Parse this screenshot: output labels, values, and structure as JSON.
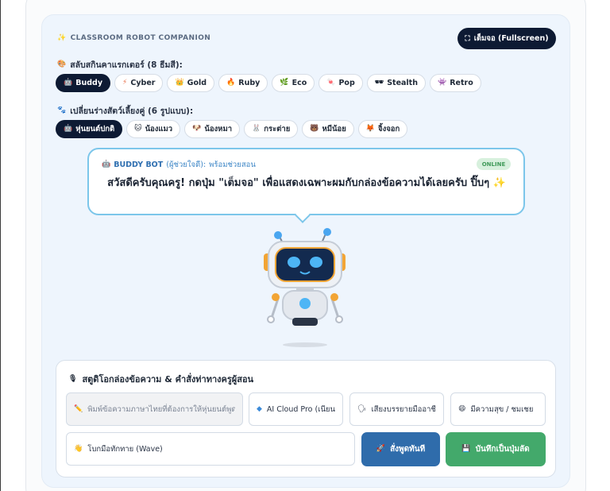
{
  "header": {
    "title": "CLASSROOM ROBOT COMPANION",
    "title_icon": "sparkle-icon",
    "fullscreen_label": "เต็มจอ (Fullscreen)"
  },
  "characters": {
    "label": "สลับสกินคาแรกเตอร์ (8 ธีมสี):",
    "items": [
      {
        "label": "Buddy",
        "icon": "robot-icon",
        "active": true
      },
      {
        "label": "Cyber",
        "icon": "lightning-icon",
        "active": false
      },
      {
        "label": "Gold",
        "icon": "crown-icon",
        "active": false
      },
      {
        "label": "Ruby",
        "icon": "flame-icon",
        "active": false
      },
      {
        "label": "Eco",
        "icon": "leaf-icon",
        "active": false
      },
      {
        "label": "Pop",
        "icon": "candy-icon",
        "active": false
      },
      {
        "label": "Stealth",
        "icon": "mask-icon",
        "active": false
      },
      {
        "label": "Retro",
        "icon": "invader-icon",
        "active": false
      }
    ]
  },
  "pets": {
    "label": "เปลี่ยนร่างสัตว์เลี้ยงคู่ (6 รูปแบบ):",
    "items": [
      {
        "label": "หุ่นยนต์ปกติ",
        "icon": "robot-icon",
        "active": true
      },
      {
        "label": "น้องแมว",
        "icon": "cat-icon",
        "active": false
      },
      {
        "label": "น้องหมา",
        "icon": "dog-icon",
        "active": false
      },
      {
        "label": "กระต่าย",
        "icon": "rabbit-icon",
        "active": false
      },
      {
        "label": "หมีน้อย",
        "icon": "bear-icon",
        "active": false
      },
      {
        "label": "จิ้งจอก",
        "icon": "fox-icon",
        "active": false
      }
    ]
  },
  "bubble": {
    "name": "BUDDY BOT",
    "role": "(ผู้ช่วยใจดี):",
    "status": "พร้อมช่วยสอน",
    "online": "ONLINE",
    "message": "สวัสดีครับคุณครู! กดปุ่ม \"เต็มจอ\" เพื่อแสดงเฉพาะผมกับกล่องข้อความได้เลยครับ ปิ๊บๆ ✨"
  },
  "studio": {
    "title": "สตูดิโอกล่องข้อความ & คำสั่งท่าทางครูผู้สอน",
    "text_placeholder": "พิมพ์ข้อความภาษาไทยที่ต้องการให้หุ่นยนต์พูด",
    "voice_engine": "AI Cloud Pro (เนียน)",
    "voice_style": "เสียงบรรยายมืออาชีพ",
    "emotion": "มีความสุข / ชมเชย",
    "gesture": "โบกมือทักทาย (Wave)",
    "speak_label": "สั่งพูดทันที",
    "save_label": "บันทึกเป็นปุ่มลัด"
  },
  "colors": {
    "dark": "#0d1a33",
    "accent_blue": "#2f6fb0",
    "speak_button": "#2f6cab",
    "save_button": "#43a96b",
    "bubble_border": "#7cc6ea"
  }
}
